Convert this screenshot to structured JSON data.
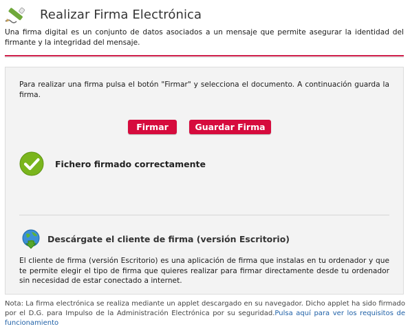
{
  "header": {
    "title": "Realizar Firma Electrónica",
    "icon": "pencil-sign-icon"
  },
  "intro": {
    "text": "Una firma digital es un conjunto de datos asociados a un mensaje que permite asegurar la identidad del firmante y la integridad del mensaje."
  },
  "colors": {
    "accent": "#cf1e4a",
    "button": "#d60b3d",
    "success": "#7ab51d",
    "link": "#1d5fa6"
  },
  "panel": {
    "instruction": "Para realizar una firma pulsa el botón \"Firmar\" y selecciona el documento. A continuación guarda la firma.",
    "buttons": {
      "sign_label": "Firmar",
      "save_label": "Guardar Firma"
    },
    "status": {
      "icon": "checkmark-circle-icon",
      "text": "Fichero firmado correctamente"
    },
    "client": {
      "icon": "globe-download-icon",
      "title": "Descárgate el cliente de firma (versión Escritorio)",
      "description": "El cliente de firma (versión Escritorio) es una aplicación de firma que instalas en tu ordenador y que te permite elegir el tipo de firma que quieres realizar para firmar directamente desde tu ordenador sin necesidad de estar conectado a internet."
    }
  },
  "note": {
    "text": "Nota: La firma electrónica se realiza mediante un applet descargado en su navegador. Dicho applet ha sido firmado por el D.G. para Impulso de la Administración Electrónica por su seguridad.",
    "link_text": "Pulsa aquí para ver los requisitos de funcionamiento"
  }
}
